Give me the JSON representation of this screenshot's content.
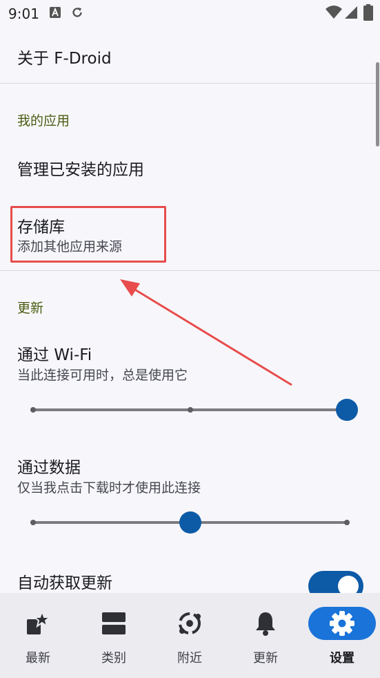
{
  "status_bar": {
    "time": "9:01",
    "icons": [
      "a-notification-icon",
      "sync-icon",
      "wifi-icon",
      "cellular-icon",
      "battery-icon"
    ]
  },
  "header": {
    "about_label": "关于 F-Droid"
  },
  "my_apps": {
    "category": "我的应用",
    "manage_installed": "管理已安装的应用",
    "repositories_title": "存储库",
    "repositories_summary": "添加其他应用来源"
  },
  "updates": {
    "category": "更新",
    "over_wifi_title": "通过 Wi-Fi",
    "over_wifi_summary": "当此连接可用时，总是使用它",
    "over_wifi_level": 1.0,
    "over_data_title": "通过数据",
    "over_data_summary": "仅当我点击下载时才使用此连接",
    "over_data_level": 0.5,
    "auto_fetch_title": "自动获取更新",
    "auto_fetch_enabled": true
  },
  "bottom_nav": {
    "latest": "最新",
    "categories": "类别",
    "nearby": "附近",
    "updates": "更新",
    "settings": "设置"
  },
  "colors": {
    "accent": "#0d5aa7",
    "category_text": "#4a5c12",
    "highlight": "#e84c4c",
    "active_nav": "#1a73d8"
  }
}
